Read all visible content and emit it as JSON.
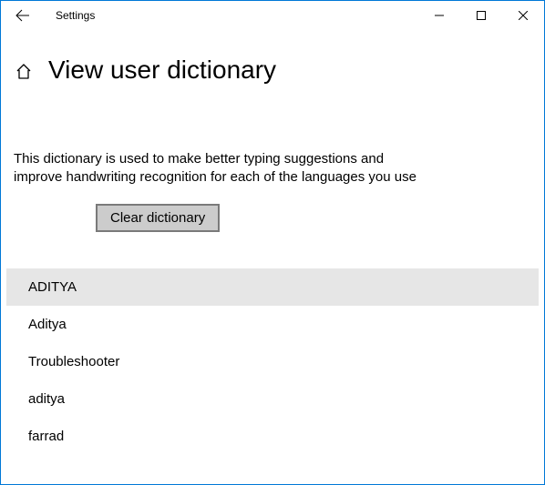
{
  "titlebar": {
    "title": "Settings"
  },
  "header": {
    "page_title": "View user dictionary"
  },
  "description": "This dictionary is used to make better typing suggestions and improve handwriting recognition for each of the languages you use",
  "buttons": {
    "clear": "Clear dictionary"
  },
  "words": [
    {
      "text": "ADITYA",
      "selected": true
    },
    {
      "text": "Aditya",
      "selected": false
    },
    {
      "text": "Troubleshooter",
      "selected": false
    },
    {
      "text": "aditya",
      "selected": false
    },
    {
      "text": "farrad",
      "selected": false
    }
  ]
}
